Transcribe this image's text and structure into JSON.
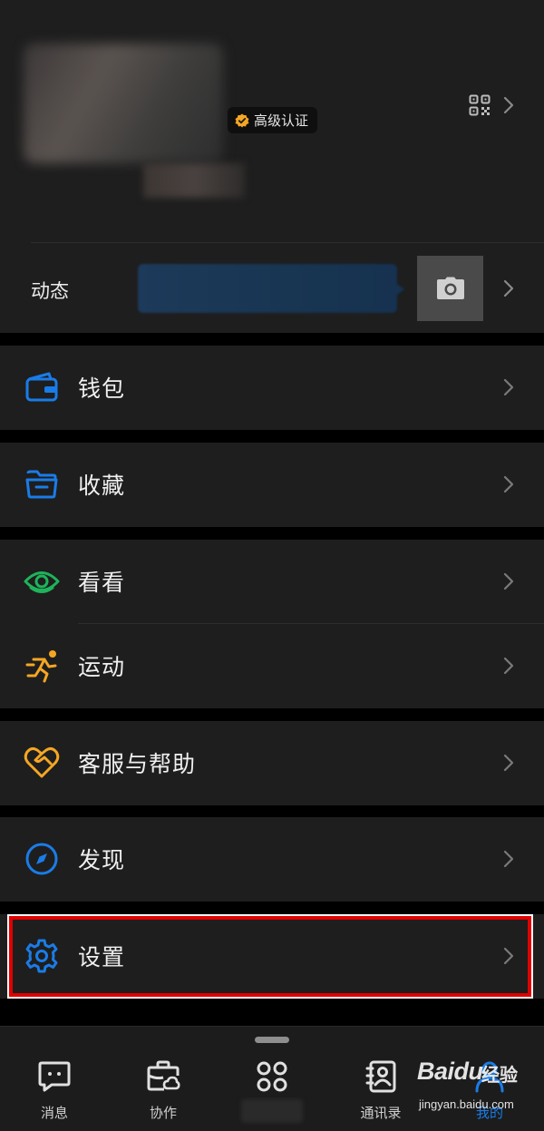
{
  "profile": {
    "badge_label": "高级认证",
    "moments_label": "动态"
  },
  "menu": {
    "wallet": "钱包",
    "favorites": "收藏",
    "kankan": "看看",
    "sports": "运动",
    "support": "客服与帮助",
    "discover": "发现",
    "settings": "设置"
  },
  "tabbar": {
    "messages": "消息",
    "collab": "协作",
    "contacts": "通讯录",
    "me": "我的"
  },
  "watermark": {
    "logo": "Baidu",
    "sub": "经验",
    "url": "jingyan.baidu.com"
  },
  "colors": {
    "accent_blue": "#1a7ce8",
    "kankan_green": "#1fb35b",
    "orange": "#f5a623",
    "highlight_red": "#e00000"
  }
}
